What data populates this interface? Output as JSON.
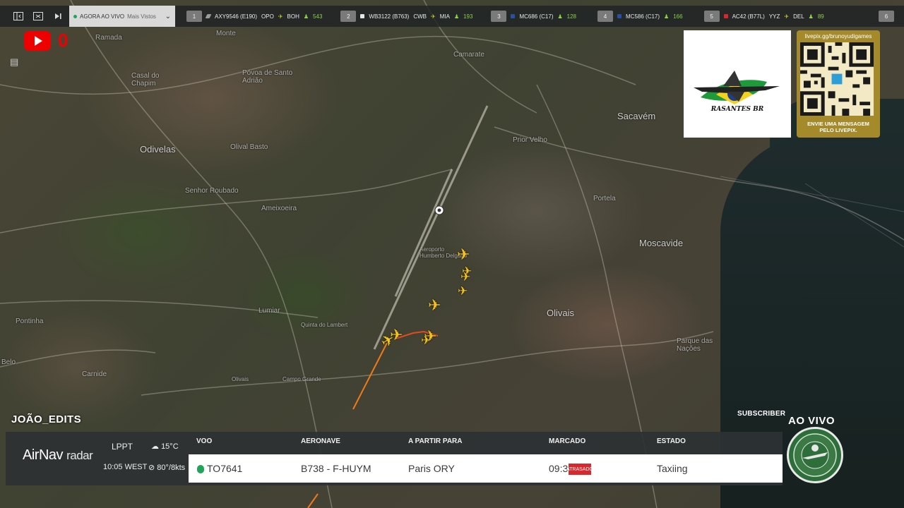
{
  "topbar": {
    "select": {
      "label": "AGORA AO VIVO",
      "sub": "Mais Vistos"
    },
    "flights": [
      {
        "num": "1",
        "callsign": "AXY9546 (E190)",
        "from": "OPO",
        "to": "BOH",
        "alt": "543",
        "color": "#9a9a9a"
      },
      {
        "num": "2",
        "callsign": "WB3122 (B763)",
        "from": "CWB",
        "to": "MIA",
        "alt": "193",
        "color": "#d9d9d9"
      },
      {
        "num": "3",
        "callsign": "MC686 (C17)",
        "from": "",
        "to": "",
        "alt": "128",
        "color": "#2b4fa0"
      },
      {
        "num": "4",
        "callsign": "MC586 (C17)",
        "from": "",
        "to": "",
        "alt": "166",
        "color": "#2b4fa0"
      },
      {
        "num": "5",
        "callsign": "AC42 (B77L)",
        "from": "YYZ",
        "to": "DEL",
        "alt": "89",
        "color": "#d9272e"
      },
      {
        "num": "6",
        "callsign": "",
        "from": "",
        "to": "",
        "alt": "",
        "color": "#9a9a9a"
      }
    ]
  },
  "overlay": {
    "youtube_count": "0",
    "logo_text": "RASANTES BR",
    "qr_url": "livepix.gg/brunoyudigames",
    "qr_message": "ENVIE UMA MENSAGEM PELO LIVEPIX."
  },
  "map": {
    "places": [
      "Monte",
      "Ramada",
      "Camarate",
      "Casal do Chapim",
      "Póvoa de Santo Adrião",
      "Sacavém",
      "Odivelas",
      "Olival Basto",
      "Prior Velho",
      "Senhor Roubado",
      "Ameixoeira",
      "Portela",
      "Moscavide",
      "Aeroporto Humberto Delgado",
      "Lumiar",
      "Olivais",
      "Pontinha",
      "Parque das Nações",
      "Carnide",
      "Quinta do Lambert",
      "Olivais",
      "Campo Grande",
      "Belo"
    ]
  },
  "panel": {
    "streamer": "JOÃO_EDITS",
    "brand_main": "AirNav",
    "brand_sub": "radar",
    "airport_code": "LPPT",
    "local_time": "10:05 WEST",
    "temperature": "15°C",
    "wind": "80°/8kts",
    "headers": {
      "flight": "VOO",
      "aircraft": "AERONAVE",
      "route": "A PARTIR PARA",
      "scheduled": "MARCADO",
      "status": "ESTADO"
    },
    "row": {
      "flight": "TO7641",
      "aircraft": "B738 - F-HUYM",
      "route": "Paris ORY",
      "scheduled": "09:35",
      "late_badge": "ATRASADO",
      "status": "Taxiing"
    },
    "subscriber_label": "SUBSCRIBER",
    "live_label": "AO VIVO"
  }
}
